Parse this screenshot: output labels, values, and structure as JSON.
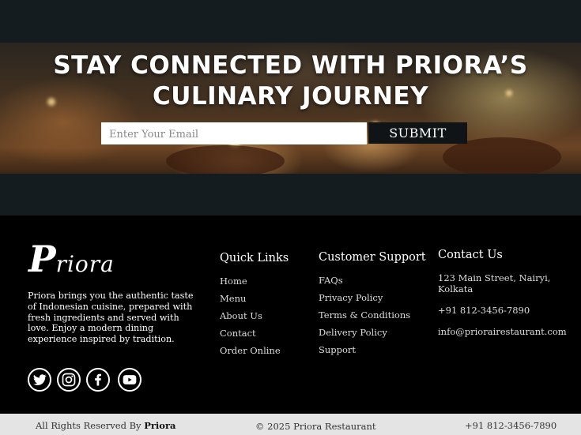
{
  "banner": {
    "title_line1": "STAY CONNECTED WITH PRIORA’S",
    "title_line2": "CULINARY JOURNEY",
    "email_placeholder": "Enter Your Email",
    "submit_label": "SUBMIT"
  },
  "footer": {
    "logo_initial": "P",
    "logo_rest": "riora",
    "about": "Priora brings you the authentic taste of Indonesian cuisine, prepared with fresh ingredients and served with love. Enjoy a modern dining experience inspired by tradition.",
    "socials": [
      {
        "icon": "twitter-icon"
      },
      {
        "icon": "instagram-icon"
      },
      {
        "icon": "facebook-icon"
      },
      {
        "icon": "youtube-icon"
      }
    ],
    "quick_links": {
      "title": "Quick Links",
      "items": [
        "Home",
        "Menu",
        "About Us",
        "Contact",
        "Order Online"
      ]
    },
    "customer_support": {
      "title": "Customer Support",
      "items": [
        "FAQs",
        "Privacy Policy",
        "Terms & Conditions",
        "Delivery Policy",
        "Support"
      ]
    },
    "contact": {
      "title": "Contact Us",
      "address": "123 Main Street, Nairyi, Kolkata",
      "phone": "+91 812-3456-7890",
      "email": "info@priorairestaurant.com"
    }
  },
  "bottom_bar": {
    "rights_prefix": "All Rights Reserved By",
    "rights_brand": "Priora",
    "copyright": "© 2025 Priora Restaurant",
    "phone": "+91 812-3456-7890"
  },
  "colors": {
    "dark_strip": "#141c20",
    "footer_bg": "#000000",
    "bottom_bar_bg": "#e4e4e4"
  }
}
